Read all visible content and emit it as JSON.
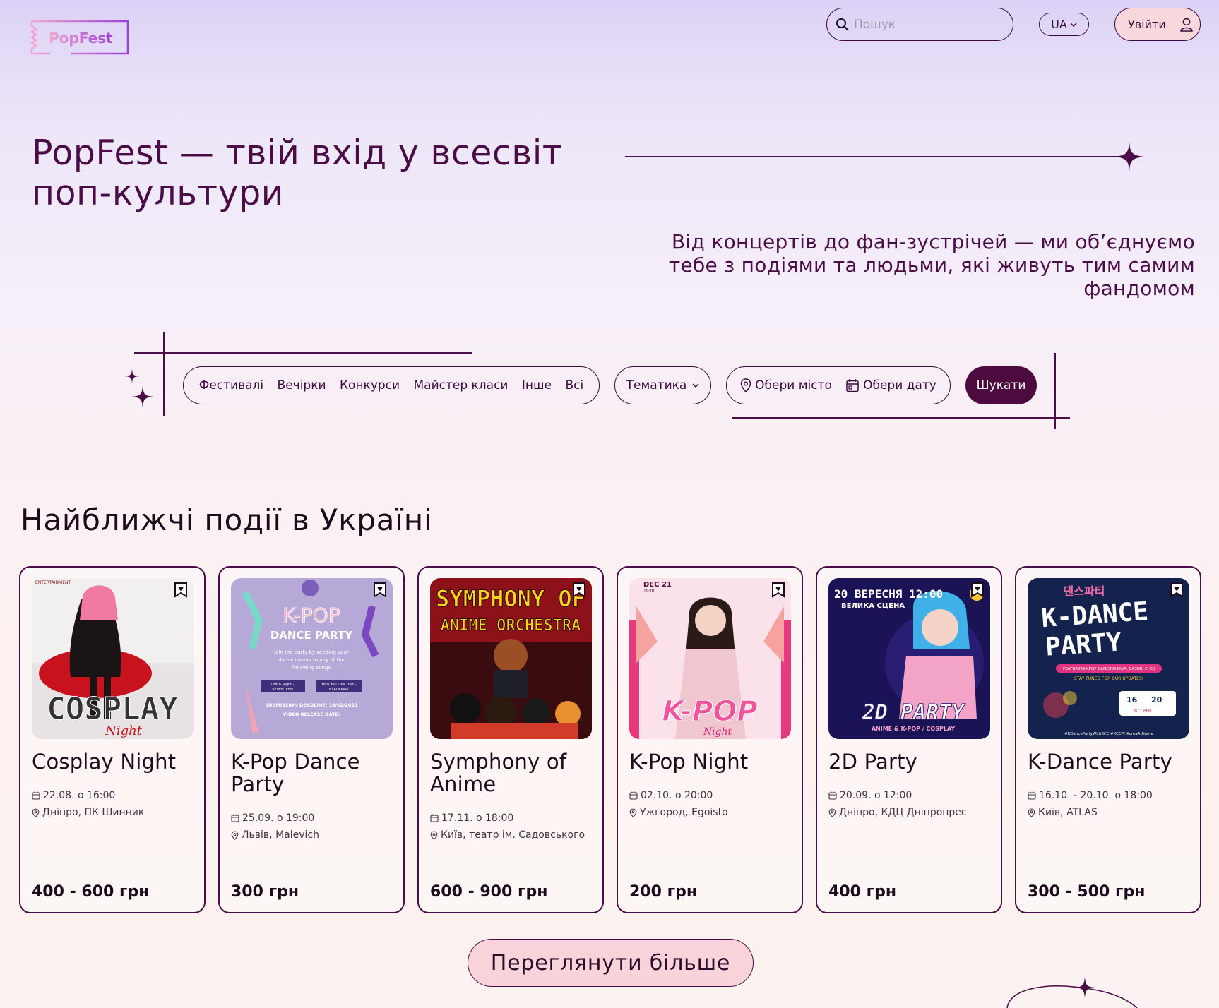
{
  "brand": {
    "logo_text": "PopFest"
  },
  "header": {
    "search_placeholder": "Пошук",
    "lang": "UA",
    "login_label": "Увійти"
  },
  "hero": {
    "title": "PopFest — твій вхід у всесвіт поп-культури",
    "subtitle": "Від концертів до фан-зустрічей — ми об’єднуємо тебе з подіями та людьми, які живуть тим самим фандомом"
  },
  "filters": {
    "categories": [
      "Фестивалі",
      "Вечірки",
      "Конкурси",
      "Майстер класи",
      "Інше",
      "Всі"
    ],
    "theme_label": "Тематика",
    "city_label": "Обери місто",
    "date_label": "Обери дату",
    "search_button": "Шукати"
  },
  "events": {
    "section_title": "Найближчі події в Україні",
    "items": [
      {
        "title": "Cosplay Night",
        "date": "22.08. о 16:00",
        "place": "Дніпро, ПК Шинник",
        "price": "400 - 600 грн",
        "poster_text": "COSPLAY",
        "poster_sub": "Night",
        "poster_top": "ENTERTAINMENT"
      },
      {
        "title": "K-Pop Dance Party",
        "date": "25.09. о 19:00",
        "place": "Львів, Malevich",
        "price": "300 грн",
        "poster_text": "K-POP",
        "poster_sub": "DANCE PARTY",
        "poster_top": "SUBMISSION DEADLINE: 16/02/2021"
      },
      {
        "title": "Symphony of Anime",
        "date": "17.11. о 18:00",
        "place": "Київ, театр ім. Садовського",
        "price": "600 - 900 грн",
        "poster_text": "SYMPHONY OF",
        "poster_sub": "ANIME ORCHESTRA",
        "poster_top": ""
      },
      {
        "title": "K-Pop Night",
        "date": "02.10. о 20:00",
        "place": "Ужгород, Egoisto",
        "price": "200 грн",
        "poster_text": "K-POP",
        "poster_sub": "Night",
        "poster_top": "DEC 21"
      },
      {
        "title": "2D Party",
        "date": "20.09. о 12:00",
        "place": "Дніпро, КДЦ Дніпропрес",
        "price": "400 грн",
        "poster_text": "2D PARTY",
        "poster_sub": "ANIME & K-POP / COSPLAY",
        "poster_top": "20 ВЕРЕСНЯ 12:00"
      },
      {
        "title": "K-Dance Party",
        "date": "16.10. - 20.10. о 18:00",
        "place": "Київ, ATLAS",
        "price": "300 - 500 грн",
        "poster_text": "K-DANCE",
        "poster_sub": "PARTY",
        "poster_top": "댄스파티"
      }
    ],
    "more_button": "Переглянути більше"
  }
}
